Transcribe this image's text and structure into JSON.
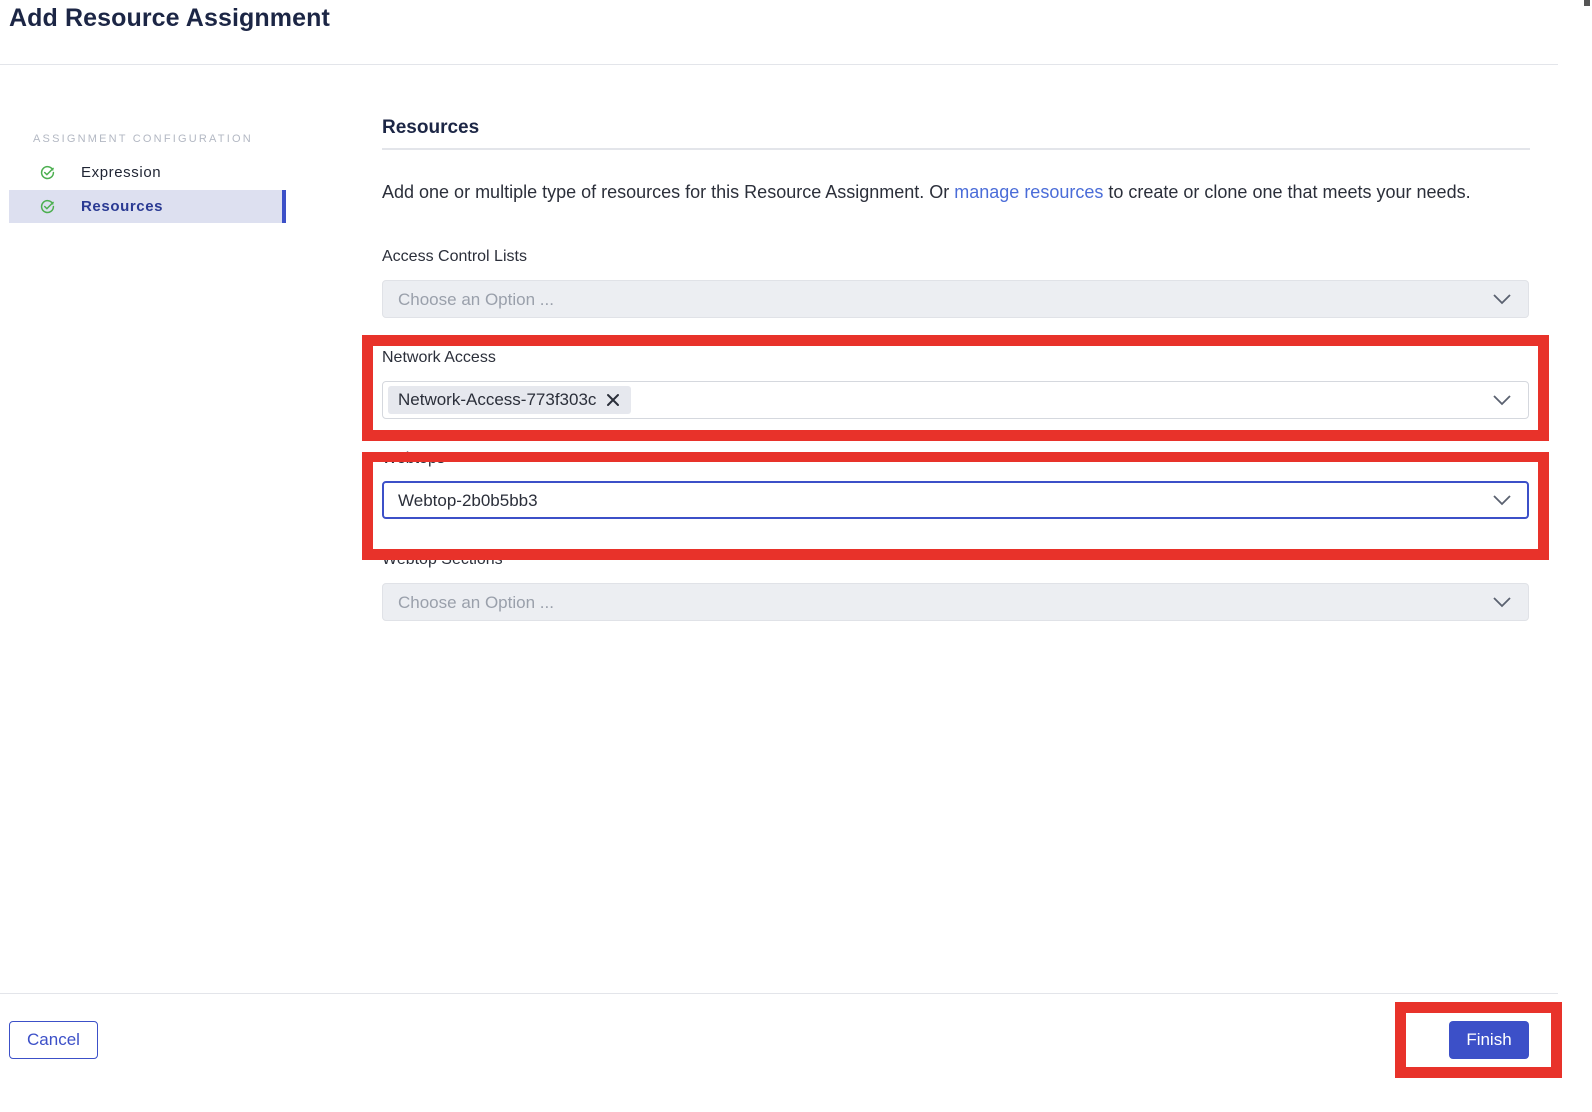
{
  "page": {
    "title": "Add Resource Assignment"
  },
  "sidebar": {
    "heading": "ASSIGNMENT CONFIGURATION",
    "items": [
      {
        "label": "Expression",
        "status": "complete",
        "active": false
      },
      {
        "label": "Resources",
        "status": "complete",
        "active": true
      }
    ]
  },
  "main": {
    "section_title": "Resources",
    "intro": {
      "text_before": "Add one or multiple type of resources for this Resource Assignment. Or ",
      "link": "manage resources",
      "text_after": " to create or clone one that meets your needs."
    },
    "fields": {
      "acl": {
        "label": "Access Control Lists",
        "placeholder": "Choose an Option ..."
      },
      "network_access": {
        "label": "Network Access",
        "tags": [
          "Network-Access-773f303c"
        ]
      },
      "webtops": {
        "label": "Webtops",
        "value": "Webtop-2b0b5bb3"
      },
      "webtop_sections": {
        "label": "Webtop Sections",
        "placeholder": "Choose an Option ..."
      }
    }
  },
  "footer": {
    "cancel_label": "Cancel",
    "finish_label": "Finish"
  },
  "colors": {
    "accent": "#3c50c8",
    "highlight": "#e8322a",
    "check": "#4caf50",
    "link": "#4a6cd8"
  },
  "icons": {
    "check": "check-circle-icon",
    "chevron": "chevron-down-icon",
    "remove": "close-icon"
  }
}
